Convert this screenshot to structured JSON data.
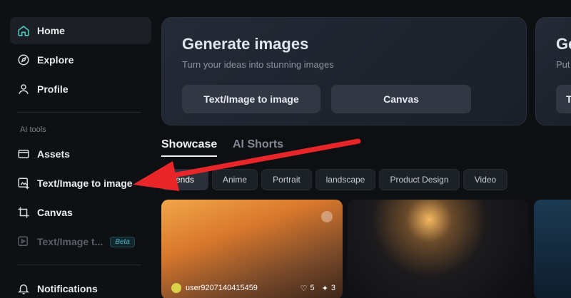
{
  "sidebar": {
    "items": [
      {
        "label": "Home",
        "icon": "home-icon"
      },
      {
        "label": "Explore",
        "icon": "compass-icon"
      },
      {
        "label": "Profile",
        "icon": "user-icon"
      }
    ],
    "section_label": "AI tools",
    "tools": [
      {
        "label": "Assets",
        "icon": "folder-icon"
      },
      {
        "label": "Text/Image to image",
        "icon": "image-plus-icon"
      },
      {
        "label": "Canvas",
        "icon": "crop-icon"
      },
      {
        "label": "Text/Image t...",
        "icon": "video-plus-icon",
        "badge": "Beta"
      }
    ],
    "notifications": "Notifications"
  },
  "main": {
    "card1": {
      "title": "Generate images",
      "subtitle": "Turn your ideas into stunning images",
      "btn1": "Text/Image to image",
      "btn2": "Canvas"
    },
    "card2": {
      "title": "Ge",
      "subtitle": "Put",
      "btn": "T"
    },
    "tabs": [
      "Showcase",
      "AI Shorts"
    ],
    "chips": [
      "ends",
      "Anime",
      "Portrait",
      "landscape",
      "Product Design",
      "Video"
    ],
    "thumb1": {
      "user": "user9207140415459",
      "likes": "5",
      "remixes": "3"
    }
  },
  "colors": {
    "accent": "#e8262a",
    "background": "#0d0f12"
  }
}
